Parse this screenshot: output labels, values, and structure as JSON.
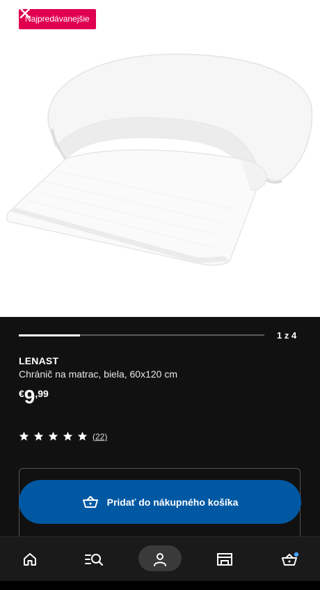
{
  "badge": {
    "label": "Najpredávanejšie"
  },
  "gallery": {
    "pager_text": "1 z 4",
    "progress_fraction": 0.25
  },
  "product": {
    "brand": "LENAST",
    "description": "Chránič na matrac, biela, 60x120 cm",
    "price_currency": "€",
    "price_integer": "9",
    "price_decimal": ",99",
    "rating_stars": 5,
    "reviews_count": "(22)"
  },
  "actions": {
    "add_to_cart_label": "Pridať do nákupného košíka"
  },
  "nav": {
    "items": [
      {
        "icon": "home-icon"
      },
      {
        "icon": "search-list-icon"
      },
      {
        "icon": "profile-icon",
        "active": true
      },
      {
        "icon": "store-icon"
      },
      {
        "icon": "cart-icon",
        "has_dot": true
      }
    ]
  },
  "colors": {
    "badge": "#e0004f",
    "accent_blue": "#0058a3",
    "cart_dot": "#4aa3ff",
    "panel_bg": "#111111"
  }
}
